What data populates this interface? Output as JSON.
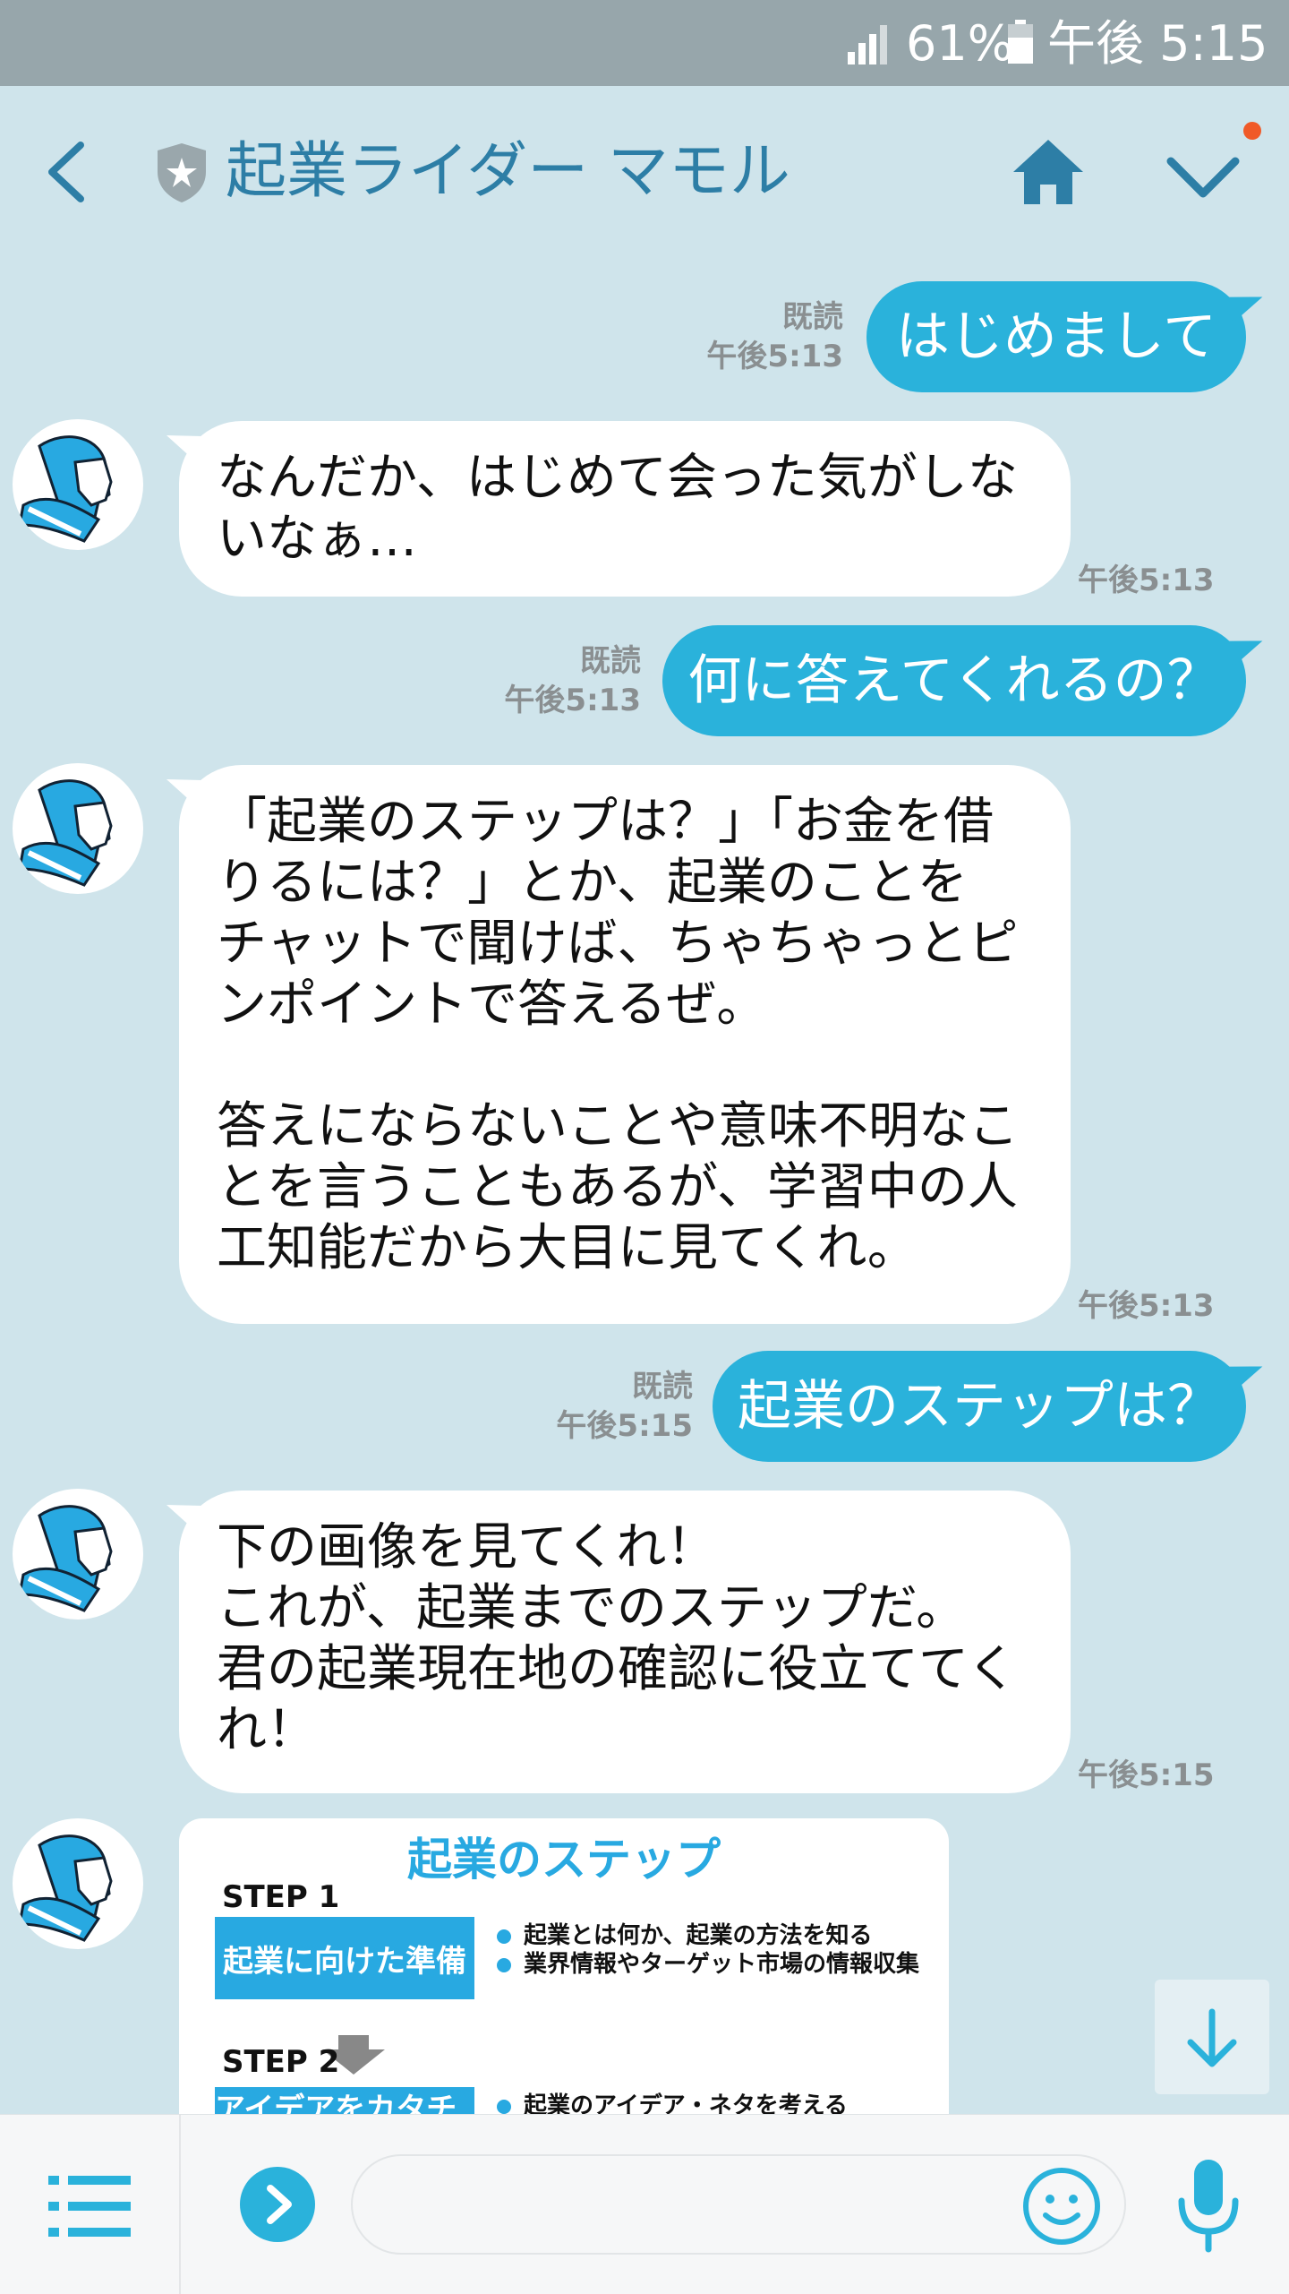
{
  "status_bar": {
    "battery": "61%",
    "time": "午後 5:15"
  },
  "header": {
    "title": "起業ライダー マモル"
  },
  "messages": [
    {
      "side": "out",
      "text": "はじめまして",
      "read": "既読",
      "time": "午後5:13"
    },
    {
      "side": "in",
      "text": "なんだか、はじめて会った気がしな\nいなぁ…",
      "time": "午後5:13"
    },
    {
      "side": "out",
      "text": "何に答えてくれるの？",
      "read": "既読",
      "time": "午後5:13"
    },
    {
      "side": "in",
      "text": "「起業のステップは？」「お金を借\nりるには？」とか、起業のことを\nチャットで聞けば、ちゃちゃっとピ\nンポイントで答えるぜ。\n\n答えにならないことや意味不明なこ\nとを言うこともあるが、学習中の人\n工知能だから大目に見てくれ。",
      "time": "午後5:13"
    },
    {
      "side": "out",
      "text": "起業のステップは？",
      "read": "既読",
      "time": "午後5:15"
    },
    {
      "side": "in",
      "text": "下の画像を見てくれ！\nこれが、起業までのステップだ。\n君の起業現在地の確認に役立ててく\nれ！",
      "time": "午後5:15"
    }
  ],
  "image_card": {
    "title": "起業のステップ",
    "step1_label": "STEP 1",
    "step1_box": "起業に向けた準備",
    "step1_bullets": [
      "起業とは何か、起業の方法を知る",
      "業界情報やターゲット市場の情報収集"
    ],
    "step2_label": "STEP 2",
    "step2_box": "アイデアをカタチにする",
    "step2_bullets": [
      "起業のアイデア・ネタを考える"
    ]
  },
  "input": {
    "placeholder": ""
  },
  "colors": {
    "background": "#cfe4eb",
    "accent": "#2ab2db",
    "title": "#2d7ea6",
    "notification": "#f05a28"
  },
  "icons": [
    "signal-icon",
    "battery-icon",
    "back-icon",
    "shield-icon",
    "home-icon",
    "chevron-down-icon",
    "arrow-down-icon",
    "menu-icon",
    "chevron-right-icon",
    "smiley-icon",
    "microphone-icon"
  ]
}
